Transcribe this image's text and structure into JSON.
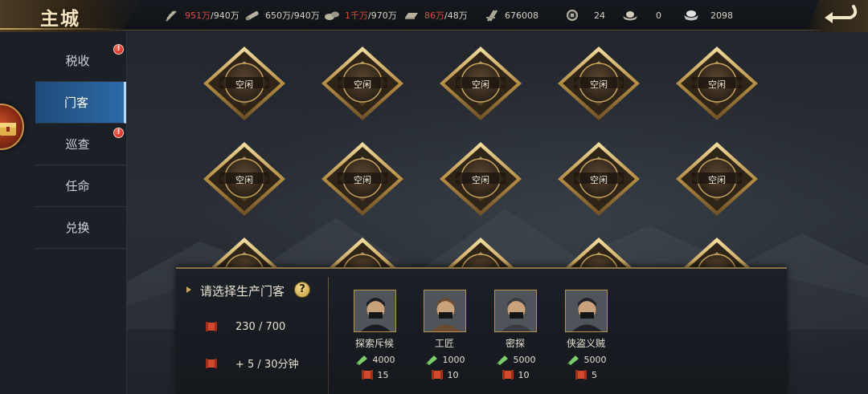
{
  "header": {
    "title": "主城",
    "resources": [
      {
        "icon": "grain-icon",
        "current": "951万",
        "cap": "/940万",
        "over": true
      },
      {
        "icon": "wood-icon",
        "current": "650万",
        "cap": "/940万",
        "over": false
      },
      {
        "icon": "stone-icon",
        "current": "1千万",
        "cap": "/970万",
        "over": true
      },
      {
        "icon": "iron-icon",
        "current": "86万",
        "cap": "/48万",
        "over": true
      },
      {
        "icon": "power-icon",
        "current": "676008",
        "cap": "",
        "over": false
      },
      {
        "icon": "coin-icon",
        "current": "24",
        "cap": "",
        "over": false
      },
      {
        "icon": "gold-ingot-icon",
        "current": "0",
        "cap": "",
        "over": false
      },
      {
        "icon": "silver-ingot-icon",
        "current": "2098",
        "cap": "",
        "over": false
      }
    ]
  },
  "sidebar": {
    "items": [
      {
        "label": "税收",
        "alert": true,
        "active": false
      },
      {
        "label": "门客",
        "alert": false,
        "active": true
      },
      {
        "label": "巡查",
        "alert": true,
        "active": false
      },
      {
        "label": "任命",
        "alert": false,
        "active": false
      },
      {
        "label": "兑换",
        "alert": false,
        "active": false
      }
    ],
    "alert_mark": "!"
  },
  "slots": {
    "label": "空闲",
    "rows": 3,
    "cols": 5
  },
  "panel": {
    "title": "请选择生产门客",
    "help_mark": "?",
    "capacity": "230 / 700",
    "rate": "+ 5 / 30分钟",
    "retainers": [
      {
        "name": "探索斥候",
        "cost": "4000",
        "output": "15"
      },
      {
        "name": "工匠",
        "cost": "1000",
        "output": "10"
      },
      {
        "name": "密探",
        "cost": "5000",
        "output": "10"
      },
      {
        "name": "侠盗义贼",
        "cost": "5000",
        "output": "5"
      }
    ]
  },
  "colors": {
    "accent_gold": "#c9a65e",
    "alert_red": "#e14a3c",
    "active_tab_blue": "#2c6aa6"
  }
}
